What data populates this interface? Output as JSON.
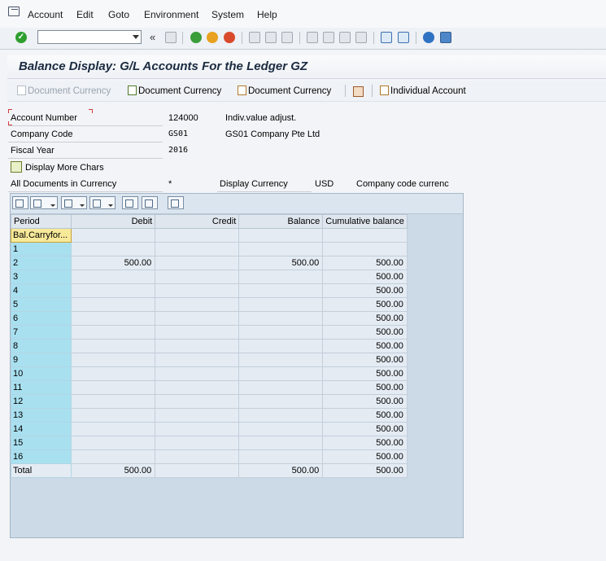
{
  "menu": {
    "items": [
      "Account",
      "Edit",
      "Goto",
      "Environment",
      "System",
      "Help"
    ]
  },
  "command_field": {
    "value": ""
  },
  "title": "Balance Display: G/L Accounts For the Ledger GZ",
  "app_toolbar": {
    "buttons": [
      "Document Currency",
      "Document Currency",
      "Document Currency",
      "Individual Account"
    ]
  },
  "header": {
    "account_number_label": "Account Number",
    "account_number": "124000",
    "account_name": "Indiv.value adjust.",
    "company_code_label": "Company Code",
    "company_code": "GS01",
    "company_name": "GS01 Company Pte Ltd",
    "fiscal_year_label": "Fiscal Year",
    "fiscal_year": "2016",
    "more_chars_label": "Display More Chars",
    "all_docs_label": "All Documents in Currency",
    "all_docs_value": "*",
    "display_currency_label": "Display Currency",
    "display_currency": "USD",
    "currency_type": "Company code currenc"
  },
  "grid": {
    "columns": [
      "Period",
      "Debit",
      "Credit",
      "Balance",
      "Cumulative balance"
    ],
    "rows": [
      [
        "Bal.Carryfor...",
        "",
        "",
        "",
        ""
      ],
      [
        "1",
        "",
        "",
        "",
        ""
      ],
      [
        "2",
        "500.00",
        "",
        "500.00",
        "500.00"
      ],
      [
        "3",
        "",
        "",
        "",
        "500.00"
      ],
      [
        "4",
        "",
        "",
        "",
        "500.00"
      ],
      [
        "5",
        "",
        "",
        "",
        "500.00"
      ],
      [
        "6",
        "",
        "",
        "",
        "500.00"
      ],
      [
        "7",
        "",
        "",
        "",
        "500.00"
      ],
      [
        "8",
        "",
        "",
        "",
        "500.00"
      ],
      [
        "9",
        "",
        "",
        "",
        "500.00"
      ],
      [
        "10",
        "",
        "",
        "",
        "500.00"
      ],
      [
        "11",
        "",
        "",
        "",
        "500.00"
      ],
      [
        "12",
        "",
        "",
        "",
        "500.00"
      ],
      [
        "13",
        "",
        "",
        "",
        "500.00"
      ],
      [
        "14",
        "",
        "",
        "",
        "500.00"
      ],
      [
        "15",
        "",
        "",
        "",
        "500.00"
      ],
      [
        "16",
        "",
        "",
        "",
        "500.00"
      ],
      [
        "Total",
        "500.00",
        "",
        "500.00",
        "500.00"
      ]
    ]
  }
}
